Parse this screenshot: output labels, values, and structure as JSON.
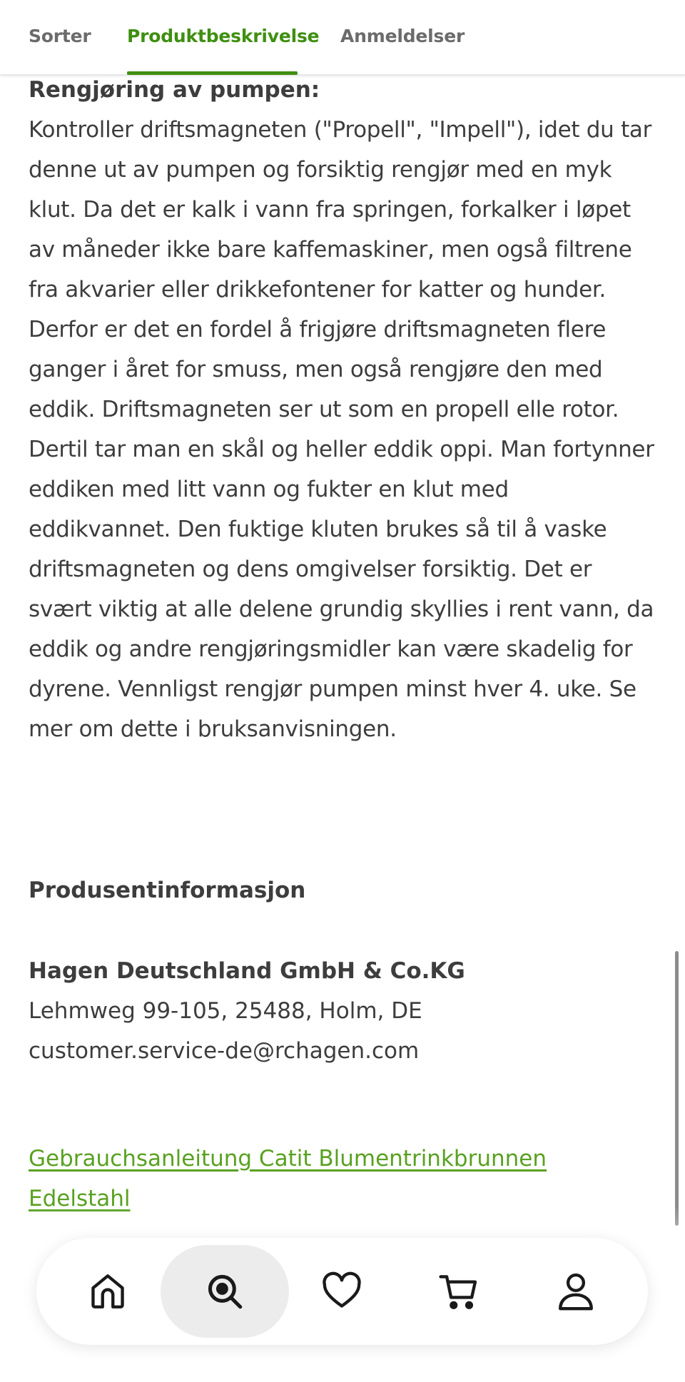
{
  "tabs": [
    {
      "label": "Sorter"
    },
    {
      "label": "Produktbeskrivelse"
    },
    {
      "label": "Anmeldelser"
    }
  ],
  "cleaning": {
    "title": "Rengjøring av pumpen:",
    "body": "Kontroller driftsmagneten (\"Propell\", \"Impell\"), idet du tar denne ut av pumpen og forsiktig rengjør med en myk klut. Da det er kalk i vann fra springen, forkalker i løpet av måneder ikke bare kaffemaskiner, men også filtrene fra akvarier eller drikkefontener for katter og hunder. Derfor er det en fordel å frigjøre driftsmagneten flere ganger i året for smuss, men også rengjøre den med eddik. Driftsmagneten ser ut som en propell elle rotor. Dertil tar man en skål og heller eddik oppi. Man fortynner eddiken med litt vann og fukter en klut med eddikvannet. Den fuktige kluten brukes så til å vaske driftsmagneten og dens omgivelser forsiktig. Det er svært viktig at alle delene grundig skyllies i rent vann, da eddik og andre rengjøringsmidler kan være skadelig for dyrene. Vennligst rengjør pumpen minst hver 4. uke. Se mer om dette i bruksanvisningen."
  },
  "producer": {
    "heading": "Produsentinformasjon",
    "company": "Hagen Deutschland GmbH & Co.KG",
    "address": "Lehmweg 99-105, 25488, Holm, DE",
    "email": "customer.service-de@rchagen.com"
  },
  "manual_link": {
    "label": "Gebrauchsanleitung Catit Blumentrinkbrunnen Edelstahl"
  },
  "bottom_nav": {
    "items": [
      {
        "icon": "home-icon"
      },
      {
        "icon": "search-icon",
        "active": true
      },
      {
        "icon": "heart-icon"
      },
      {
        "icon": "cart-icon"
      },
      {
        "icon": "user-icon"
      }
    ]
  },
  "colors": {
    "accent": "#3f8f11",
    "link": "#59a121",
    "text": "#3d3d3d"
  }
}
